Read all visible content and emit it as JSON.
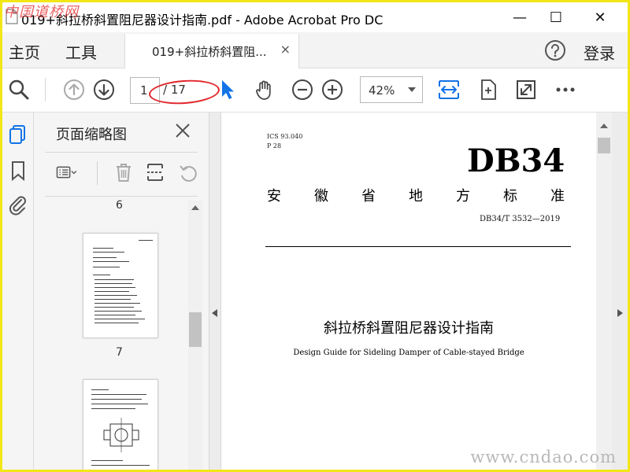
{
  "window": {
    "title": "019+斜拉桥斜置阻尼器设计指南.pdf - Adobe Acrobat Pro DC",
    "minimize_glyph": "—",
    "maximize_glyph": "☐",
    "close_glyph": "✕"
  },
  "watermarks": {
    "top_left": "中国道桥网",
    "bottom_right": "www.cndao.com"
  },
  "nav": {
    "home": "主页",
    "tools": "工具",
    "tab_label": "019+斜拉桥斜置阻...",
    "tab_close": "×",
    "login": "登录"
  },
  "toolbar": {
    "current_page": "1",
    "total_pages": "/ 17",
    "zoom": "42%"
  },
  "panel": {
    "title": "页面缩略图",
    "thumbnails": [
      {
        "label": "6"
      },
      {
        "label": "7"
      }
    ]
  },
  "document": {
    "ics": "ICS 93.040",
    "p_code": "P 28",
    "db_code": "DB34",
    "standard_name_chars": [
      "安",
      "徽",
      "省",
      "地",
      "方",
      "标",
      "准"
    ],
    "standard_number": "DB34/T 3532—2019",
    "title_cn": "斜拉桥斜置阻尼器设计指南",
    "title_en": "Design Guide for Sideling Damper of Cable-stayed Bridge"
  },
  "colors": {
    "frame_border": "#f2e617",
    "accent_blue": "#1473e6",
    "annotation_red": "#e1262a"
  }
}
